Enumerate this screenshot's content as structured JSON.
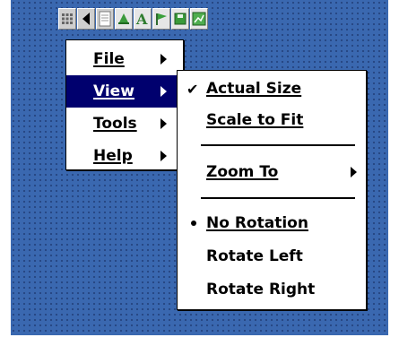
{
  "toolbar": {
    "icons": [
      {
        "name": "grid-icon"
      },
      {
        "name": "back-arrow-icon"
      },
      {
        "name": "page-icon"
      },
      {
        "name": "draw-icon"
      },
      {
        "name": "text-a-icon"
      },
      {
        "name": "flag-icon"
      },
      {
        "name": "save-icon"
      },
      {
        "name": "map-icon"
      }
    ]
  },
  "main_menu": {
    "items": [
      {
        "label": "File",
        "selected": false
      },
      {
        "label": "View",
        "selected": true
      },
      {
        "label": "Tools",
        "selected": false
      },
      {
        "label": "Help",
        "selected": false
      }
    ]
  },
  "view_submenu": {
    "actual_size": {
      "label": "Actual Size",
      "checked": true
    },
    "scale_to_fit": {
      "label": "Scale to Fit"
    },
    "zoom_to": {
      "label": "Zoom To"
    },
    "no_rotation": {
      "label": "No Rotation",
      "radio_selected": true
    },
    "rotate_left": {
      "label": "Rotate Left"
    },
    "rotate_right": {
      "label": "Rotate Right"
    }
  },
  "colors": {
    "desktop": "#3a68b0",
    "selected_bg": "#00006e",
    "menu_bg": "#ffffff"
  }
}
